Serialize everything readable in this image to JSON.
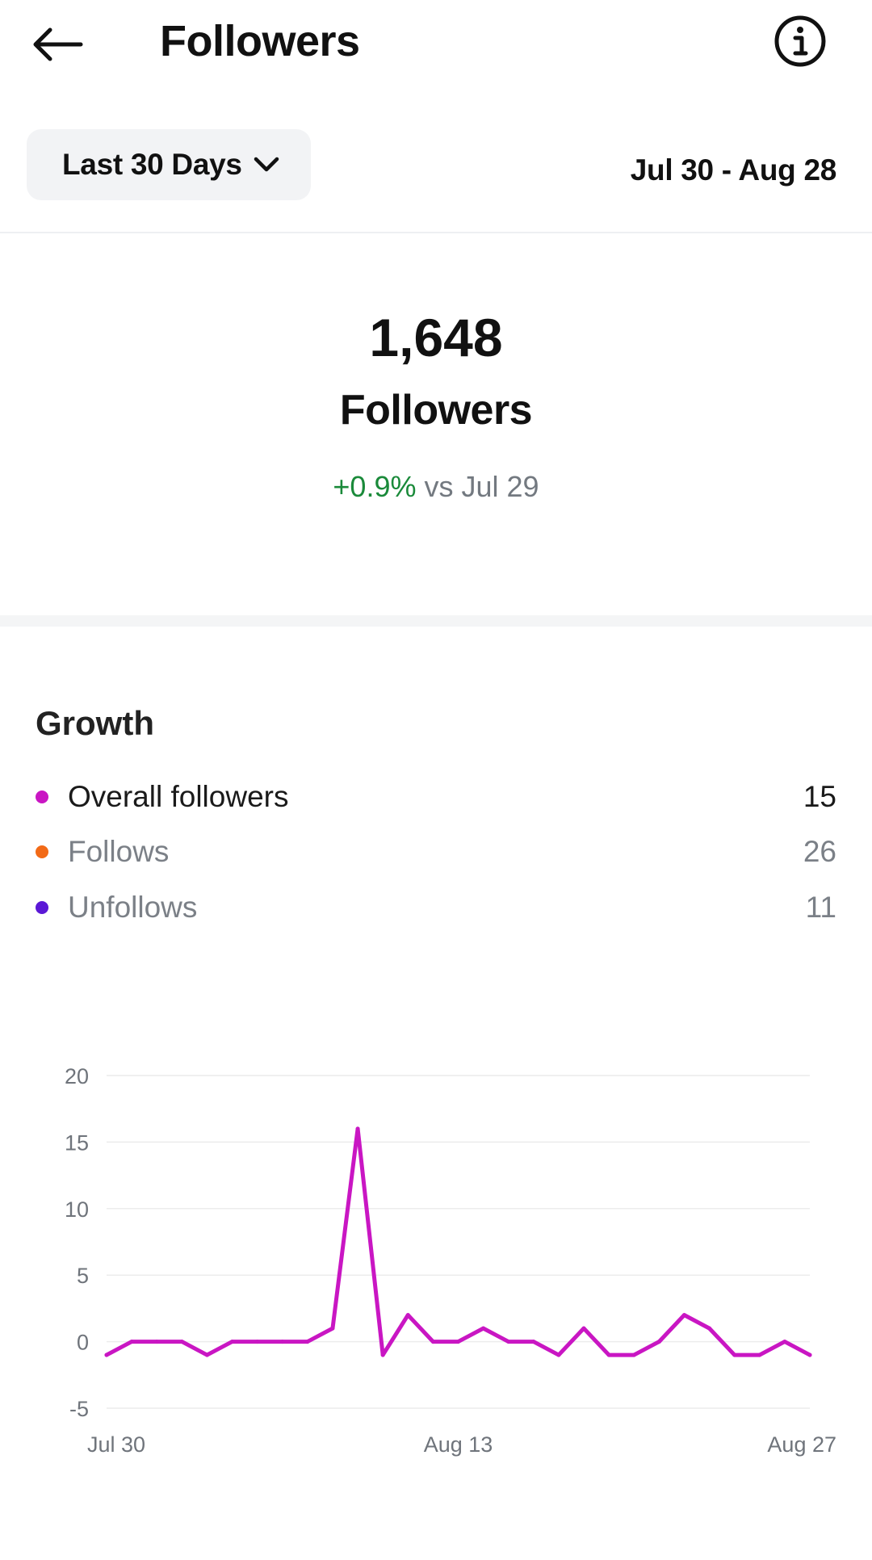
{
  "header": {
    "back_icon": "arrow-left-icon",
    "title": "Followers",
    "info_icon": "info-circle-icon"
  },
  "filter": {
    "range_label": "Last 30 Days",
    "chevron_icon": "chevron-down-icon",
    "date_range": "Jul 30 - Aug 28"
  },
  "summary": {
    "count": "1,648",
    "label": "Followers",
    "change_pct": "+0.9%",
    "change_vs": "vs Jul 29"
  },
  "growth": {
    "title": "Growth",
    "legend": [
      {
        "name": "Overall followers",
        "value": "15",
        "color": "#c916c3"
      },
      {
        "name": "Follows",
        "value": "26",
        "color": "#f26a17"
      },
      {
        "name": "Unfollows",
        "value": "11",
        "color": "#5b18d6"
      }
    ]
  },
  "chart_data": {
    "type": "line",
    "title": "",
    "xlabel": "",
    "ylabel": "",
    "ylim": [
      -5,
      20
    ],
    "yticks": [
      20,
      15,
      10,
      5,
      0,
      -5
    ],
    "x_tick_labels": [
      "Jul 30",
      "Aug 13",
      "Aug 27"
    ],
    "x_tick_index": [
      0,
      14,
      28
    ],
    "grid": true,
    "series": [
      {
        "name": "Overall followers",
        "color": "#c916c3",
        "values": [
          -1,
          0,
          0,
          0,
          -1,
          0,
          0,
          0,
          0,
          1,
          16,
          -1,
          2,
          0,
          0,
          1,
          0,
          0,
          -1,
          1,
          -1,
          -1,
          0,
          2,
          1,
          -1,
          -1,
          0,
          -1
        ]
      }
    ]
  }
}
